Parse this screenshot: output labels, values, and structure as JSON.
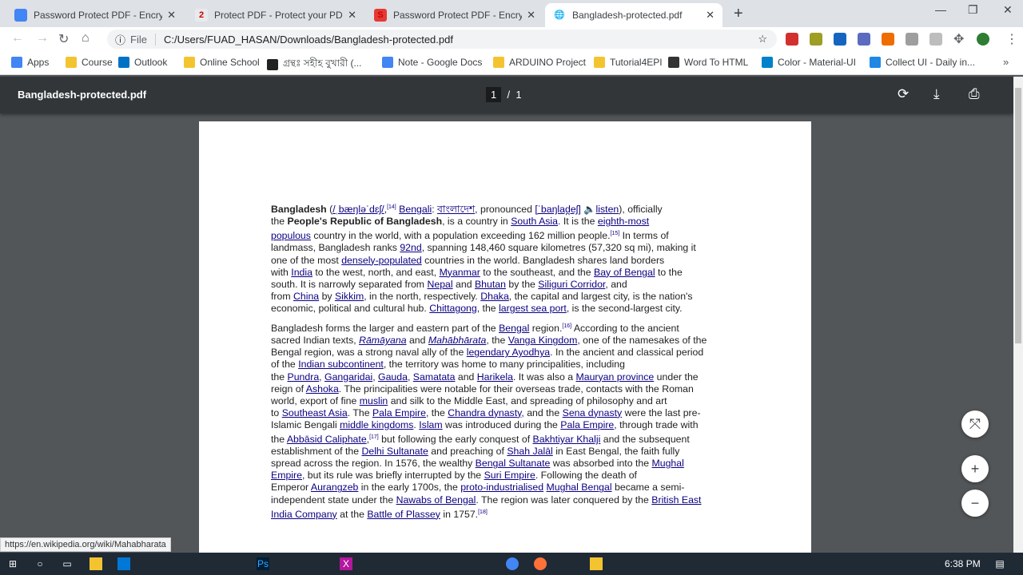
{
  "tabs": [
    {
      "title": "Password Protect PDF - Encrypt y",
      "color": "#4285f4",
      "glyph": "",
      "active": false
    },
    {
      "title": "Protect PDF - Protect your PDF d",
      "color": "#e8eaed",
      "glyph": "2",
      "active": false
    },
    {
      "title": "Password Protect PDF - Encrypt y",
      "color": "#e53935",
      "glyph": "S",
      "active": false
    },
    {
      "title": "Bangladesh-protected.pdf",
      "color": "#fff",
      "glyph": "🌐",
      "active": true
    }
  ],
  "address": {
    "scheme_label": "File",
    "url": "C:/Users/FUAD_HASAN/Downloads/Bangladesh-protected.pdf"
  },
  "bookmarks": [
    {
      "label": "Apps",
      "color": "#4285f4"
    },
    {
      "label": "Course",
      "color": "#f4c430"
    },
    {
      "label": "Outlook",
      "color": "#0072c6"
    },
    {
      "label": "Online School",
      "color": "#f4c430"
    },
    {
      "label": "গ্রন্থঃ সহীহ বুখারী (...",
      "color": "#222"
    },
    {
      "label": "Note - Google Docs",
      "color": "#4285f4"
    },
    {
      "label": "ARDUINO Project",
      "color": "#f4c430"
    },
    {
      "label": "Tutorial4EPI",
      "color": "#f4c430"
    },
    {
      "label": "Word To HTML",
      "color": "#333"
    },
    {
      "label": "Color - Material-UI",
      "color": "#0081cb"
    },
    {
      "label": "Collect UI - Daily in...",
      "color": "#1e88e5"
    }
  ],
  "pdf": {
    "title": "Bangladesh-protected.pdf",
    "current_page": "1",
    "separator": "/",
    "total_pages": "1"
  },
  "document": {
    "paragraphs": [
      [
        "**Bangladesh** ({/ˌbæŋləˈdɛʃ/},^[14] {Bengali}: {বাংলাদেশ}, pronounced {[ˈbaŋlad̪eʃ]} 🔈{listen}), officially",
        "the **People's Republic of Bangladesh**, is a country in {South Asia}. It is the {eighth-most}",
        "{populous} country in the world, with a population exceeding 162 million people.^[15] In terms of",
        "landmass, Bangladesh ranks {92nd}, spanning 148,460 square kilometres (57,320 sq mi), making it",
        "one of the most {densely-populated} countries in the world. Bangladesh shares land borders",
        "with {India} to the west, north, and east, {Myanmar} to the southeast, and the {Bay of Bengal} to the",
        "south. It is narrowly separated from {Nepal} and {Bhutan} by the {Siliguri Corridor}, and",
        "from {China} by {Sikkim}, in the north, respectively. {Dhaka}, the capital and largest city, is the nation's",
        "economic, political and cultural hub. {Chittagong}, the {largest sea port}, is the second-largest city."
      ],
      [
        "Bangladesh forms the larger and eastern part of the {Bengal} region.^[16] According to the ancient",
        "sacred Indian texts, {_Rāmāyana_} and {_Mahābhārata_}, the {Vanga Kingdom}, one of the namesakes of the",
        "Bengal region, was a strong naval ally of the {legendary Ayodhya}. In the ancient and classical period",
        "of the {Indian subcontinent}, the territory was home to many principalities, including",
        "the {Pundra}, {Gangaridai}, {Gauda}, {Samatata} and {Harikela}. It was also a {Mauryan province} under the",
        "reign of {Ashoka}. The principalities were notable for their overseas trade, contacts with the Roman",
        "world, export of fine {muslin} and silk to the Middle East, and spreading of philosophy and art",
        "to {Southeast Asia}. The {Pala Empire}, the {Chandra dynasty}, and the {Sena dynasty} were the last pre-",
        "Islamic Bengali {middle kingdoms}. {Islam} was introduced during the {Pala Empire}, through trade with",
        "the {Abbāsid Caliphate},^[17] but following the early conquest of {Bakhtiyar Khalji} and the subsequent",
        "establishment of the {Delhi Sultanate} and preaching of {Shah Jalāl} in East Bengal, the faith fully",
        "spread across the region. In 1576, the wealthy {Bengal Sultanate} was absorbed into the {Mughal}",
        "{Empire}, but its rule was briefly interrupted by the {Suri Empire}. Following the death of",
        "Emperor {Aurangzeb} in the early 1700s, the {proto-industrialised} {Mughal Bengal} became a semi-",
        "independent state under the {Nawabs of Bengal}. The region was later conquered by the {British East}",
        "{India Company} at the {Battle of Plassey} in 1757.^[18]"
      ]
    ]
  },
  "status_url": "https://en.wikipedia.org/wiki/Mahabharata",
  "taskbar": {
    "time": "6:38 PM"
  }
}
